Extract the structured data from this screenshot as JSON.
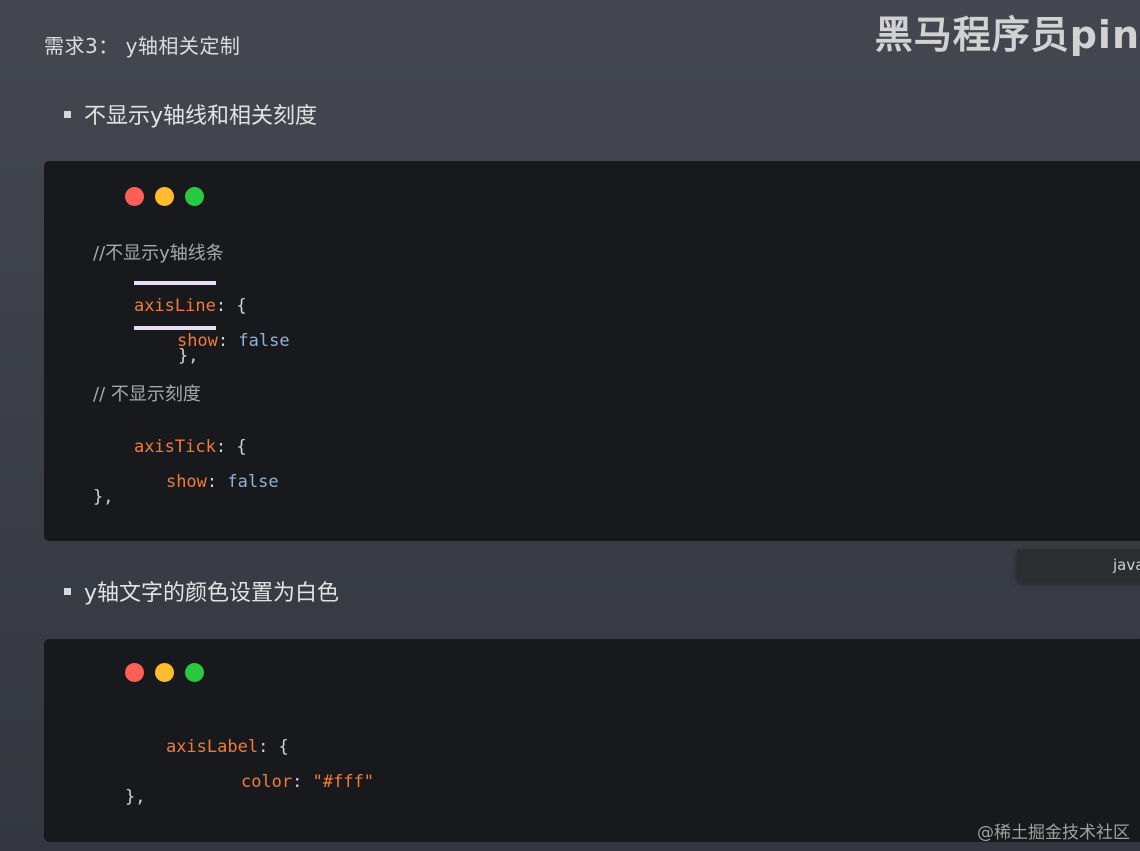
{
  "heading": "需求3： y轴相关定制",
  "watermark": "黑马程序员pin",
  "bullets": [
    "不显示y轴线和相关刻度",
    "y轴文字的颜色设置为白色"
  ],
  "code1": {
    "comment1": "//不显示y轴线条",
    "axisLine_key": "axisLine",
    "show_key": "show",
    "false_val": "false",
    "close_brace": "},",
    "comment2": "// 不显示刻度",
    "axisTick_key": "axisTick",
    "show_key2": "show",
    "false_val2": "false",
    "close_brace2": "},"
  },
  "code2": {
    "axisLabel_key": "axisLabel",
    "color_key": "color",
    "color_val": "\"#fff\"",
    "close_brace": "},"
  },
  "lang_tag": "javascript",
  "footer_watermark": "@稀土掘金技术社区",
  "colors": {
    "page_bg": "#3e4149",
    "code_bg": "#18191c",
    "key": "#f07c3a",
    "bool": "#8fb3d9",
    "comment": "#a8a8a8",
    "traffic_red": "#ff5f57",
    "traffic_yellow": "#febc2e",
    "traffic_green": "#28c840"
  }
}
